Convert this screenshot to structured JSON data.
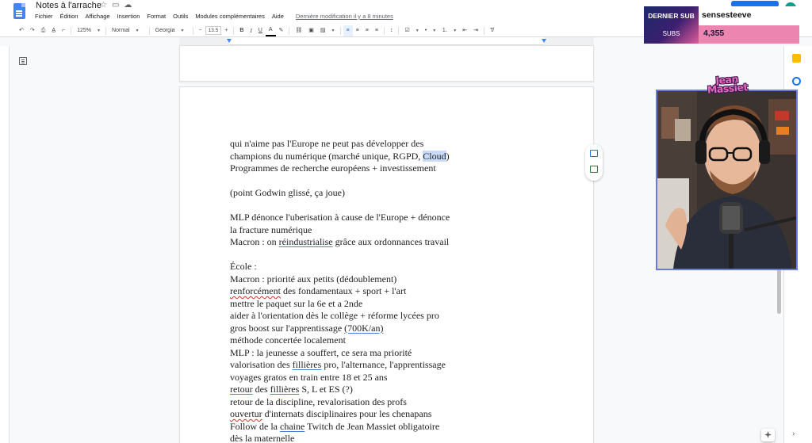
{
  "document": {
    "title": "Notes à l'arrache",
    "title_icons": [
      "star-icon",
      "move-to-folder-icon",
      "cloud-status-icon"
    ]
  },
  "menu": {
    "items": [
      "Fichier",
      "Édition",
      "Affichage",
      "Insertion",
      "Format",
      "Outils",
      "Modules complémentaires",
      "Aide"
    ],
    "last_edit": "Dernière modification il y a 8 minutes"
  },
  "toolbar": {
    "zoom": "125%",
    "style": "Normal",
    "font": "Georgia",
    "font_size": "13.5",
    "decrease": "−",
    "increase": "+",
    "bold": "B",
    "italic": "I",
    "underline": "U",
    "text_color": "A"
  },
  "body_lines": [
    "qui n'aime pas l'Europe ne peut pas développer des",
    "champions du numérique (marché unique, RGPD, Cloud)",
    "Programmes de recherche européens + investissement",
    "",
    "(point Godwin glissé, ça joue)",
    "",
    "MLP dénonce l'uberisation à cause de l'Europe + dénonce",
    "la fracture numérique",
    "Macron : on réindustrialise grâce aux ordonnances travail",
    "",
    "École :",
    "Macron : priorité aux petits (dédoublement)",
    "renforcément des fondamentaux + sport + l'art",
    "mettre le paquet sur la 6e et a 2nde",
    "aider à l'orientation dès le collège + réforme lycées pro",
    "gros boost sur l'apprentissage (700K/an)",
    "méthode concertée localement",
    "MLP : la jeunesse a souffert, ce sera ma priorité",
    "valorisation des fillières pro, l'alternance, l'apprentissage",
    "voyages gratos en train entre 18 et 25 ans",
    "retour des fillières S, L et ES (?)",
    "retour de la discipline, revalorisation des profs",
    "ouvertur d'internats disciplinaires pour les chenapans",
    "Follow de la chaine Twitch de Jean Massiet obligatoire",
    "dès la maternelle"
  ],
  "overlay": {
    "sub_label_1": "DERNIER SUB",
    "sub_label_2": "SUBS",
    "last_sub_name": "sensesteeve",
    "sub_count": "4,355",
    "cam_logo": "Jean Massiet",
    "colors": {
      "sub_gradient_start": "#1b2a6a",
      "sub_gradient_end": "#e05a9a",
      "count_bg": "#ec86b1"
    }
  },
  "colors": {
    "accent": "#1a73e8",
    "selection": "#c8dcfa",
    "spell_error": "#d93025"
  }
}
